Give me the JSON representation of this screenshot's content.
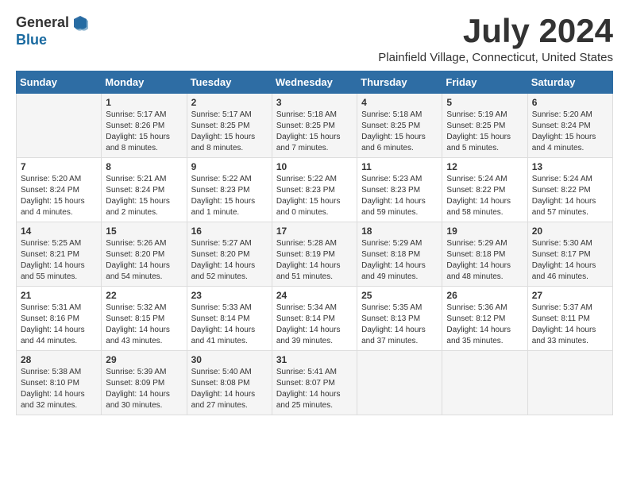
{
  "header": {
    "logo_general": "General",
    "logo_blue": "Blue",
    "month_title": "July 2024",
    "location": "Plainfield Village, Connecticut, United States"
  },
  "days_of_week": [
    "Sunday",
    "Monday",
    "Tuesday",
    "Wednesday",
    "Thursday",
    "Friday",
    "Saturday"
  ],
  "weeks": [
    [
      {
        "day": "",
        "sunrise": "",
        "sunset": "",
        "daylight": ""
      },
      {
        "day": "1",
        "sunrise": "Sunrise: 5:17 AM",
        "sunset": "Sunset: 8:26 PM",
        "daylight": "Daylight: 15 hours and 8 minutes."
      },
      {
        "day": "2",
        "sunrise": "Sunrise: 5:17 AM",
        "sunset": "Sunset: 8:25 PM",
        "daylight": "Daylight: 15 hours and 8 minutes."
      },
      {
        "day": "3",
        "sunrise": "Sunrise: 5:18 AM",
        "sunset": "Sunset: 8:25 PM",
        "daylight": "Daylight: 15 hours and 7 minutes."
      },
      {
        "day": "4",
        "sunrise": "Sunrise: 5:18 AM",
        "sunset": "Sunset: 8:25 PM",
        "daylight": "Daylight: 15 hours and 6 minutes."
      },
      {
        "day": "5",
        "sunrise": "Sunrise: 5:19 AM",
        "sunset": "Sunset: 8:25 PM",
        "daylight": "Daylight: 15 hours and 5 minutes."
      },
      {
        "day": "6",
        "sunrise": "Sunrise: 5:20 AM",
        "sunset": "Sunset: 8:24 PM",
        "daylight": "Daylight: 15 hours and 4 minutes."
      }
    ],
    [
      {
        "day": "7",
        "sunrise": "Sunrise: 5:20 AM",
        "sunset": "Sunset: 8:24 PM",
        "daylight": "Daylight: 15 hours and 4 minutes."
      },
      {
        "day": "8",
        "sunrise": "Sunrise: 5:21 AM",
        "sunset": "Sunset: 8:24 PM",
        "daylight": "Daylight: 15 hours and 2 minutes."
      },
      {
        "day": "9",
        "sunrise": "Sunrise: 5:22 AM",
        "sunset": "Sunset: 8:23 PM",
        "daylight": "Daylight: 15 hours and 1 minute."
      },
      {
        "day": "10",
        "sunrise": "Sunrise: 5:22 AM",
        "sunset": "Sunset: 8:23 PM",
        "daylight": "Daylight: 15 hours and 0 minutes."
      },
      {
        "day": "11",
        "sunrise": "Sunrise: 5:23 AM",
        "sunset": "Sunset: 8:23 PM",
        "daylight": "Daylight: 14 hours and 59 minutes."
      },
      {
        "day": "12",
        "sunrise": "Sunrise: 5:24 AM",
        "sunset": "Sunset: 8:22 PM",
        "daylight": "Daylight: 14 hours and 58 minutes."
      },
      {
        "day": "13",
        "sunrise": "Sunrise: 5:24 AM",
        "sunset": "Sunset: 8:22 PM",
        "daylight": "Daylight: 14 hours and 57 minutes."
      }
    ],
    [
      {
        "day": "14",
        "sunrise": "Sunrise: 5:25 AM",
        "sunset": "Sunset: 8:21 PM",
        "daylight": "Daylight: 14 hours and 55 minutes."
      },
      {
        "day": "15",
        "sunrise": "Sunrise: 5:26 AM",
        "sunset": "Sunset: 8:20 PM",
        "daylight": "Daylight: 14 hours and 54 minutes."
      },
      {
        "day": "16",
        "sunrise": "Sunrise: 5:27 AM",
        "sunset": "Sunset: 8:20 PM",
        "daylight": "Daylight: 14 hours and 52 minutes."
      },
      {
        "day": "17",
        "sunrise": "Sunrise: 5:28 AM",
        "sunset": "Sunset: 8:19 PM",
        "daylight": "Daylight: 14 hours and 51 minutes."
      },
      {
        "day": "18",
        "sunrise": "Sunrise: 5:29 AM",
        "sunset": "Sunset: 8:18 PM",
        "daylight": "Daylight: 14 hours and 49 minutes."
      },
      {
        "day": "19",
        "sunrise": "Sunrise: 5:29 AM",
        "sunset": "Sunset: 8:18 PM",
        "daylight": "Daylight: 14 hours and 48 minutes."
      },
      {
        "day": "20",
        "sunrise": "Sunrise: 5:30 AM",
        "sunset": "Sunset: 8:17 PM",
        "daylight": "Daylight: 14 hours and 46 minutes."
      }
    ],
    [
      {
        "day": "21",
        "sunrise": "Sunrise: 5:31 AM",
        "sunset": "Sunset: 8:16 PM",
        "daylight": "Daylight: 14 hours and 44 minutes."
      },
      {
        "day": "22",
        "sunrise": "Sunrise: 5:32 AM",
        "sunset": "Sunset: 8:15 PM",
        "daylight": "Daylight: 14 hours and 43 minutes."
      },
      {
        "day": "23",
        "sunrise": "Sunrise: 5:33 AM",
        "sunset": "Sunset: 8:14 PM",
        "daylight": "Daylight: 14 hours and 41 minutes."
      },
      {
        "day": "24",
        "sunrise": "Sunrise: 5:34 AM",
        "sunset": "Sunset: 8:14 PM",
        "daylight": "Daylight: 14 hours and 39 minutes."
      },
      {
        "day": "25",
        "sunrise": "Sunrise: 5:35 AM",
        "sunset": "Sunset: 8:13 PM",
        "daylight": "Daylight: 14 hours and 37 minutes."
      },
      {
        "day": "26",
        "sunrise": "Sunrise: 5:36 AM",
        "sunset": "Sunset: 8:12 PM",
        "daylight": "Daylight: 14 hours and 35 minutes."
      },
      {
        "day": "27",
        "sunrise": "Sunrise: 5:37 AM",
        "sunset": "Sunset: 8:11 PM",
        "daylight": "Daylight: 14 hours and 33 minutes."
      }
    ],
    [
      {
        "day": "28",
        "sunrise": "Sunrise: 5:38 AM",
        "sunset": "Sunset: 8:10 PM",
        "daylight": "Daylight: 14 hours and 32 minutes."
      },
      {
        "day": "29",
        "sunrise": "Sunrise: 5:39 AM",
        "sunset": "Sunset: 8:09 PM",
        "daylight": "Daylight: 14 hours and 30 minutes."
      },
      {
        "day": "30",
        "sunrise": "Sunrise: 5:40 AM",
        "sunset": "Sunset: 8:08 PM",
        "daylight": "Daylight: 14 hours and 27 minutes."
      },
      {
        "day": "31",
        "sunrise": "Sunrise: 5:41 AM",
        "sunset": "Sunset: 8:07 PM",
        "daylight": "Daylight: 14 hours and 25 minutes."
      },
      {
        "day": "",
        "sunrise": "",
        "sunset": "",
        "daylight": ""
      },
      {
        "day": "",
        "sunrise": "",
        "sunset": "",
        "daylight": ""
      },
      {
        "day": "",
        "sunrise": "",
        "sunset": "",
        "daylight": ""
      }
    ]
  ]
}
